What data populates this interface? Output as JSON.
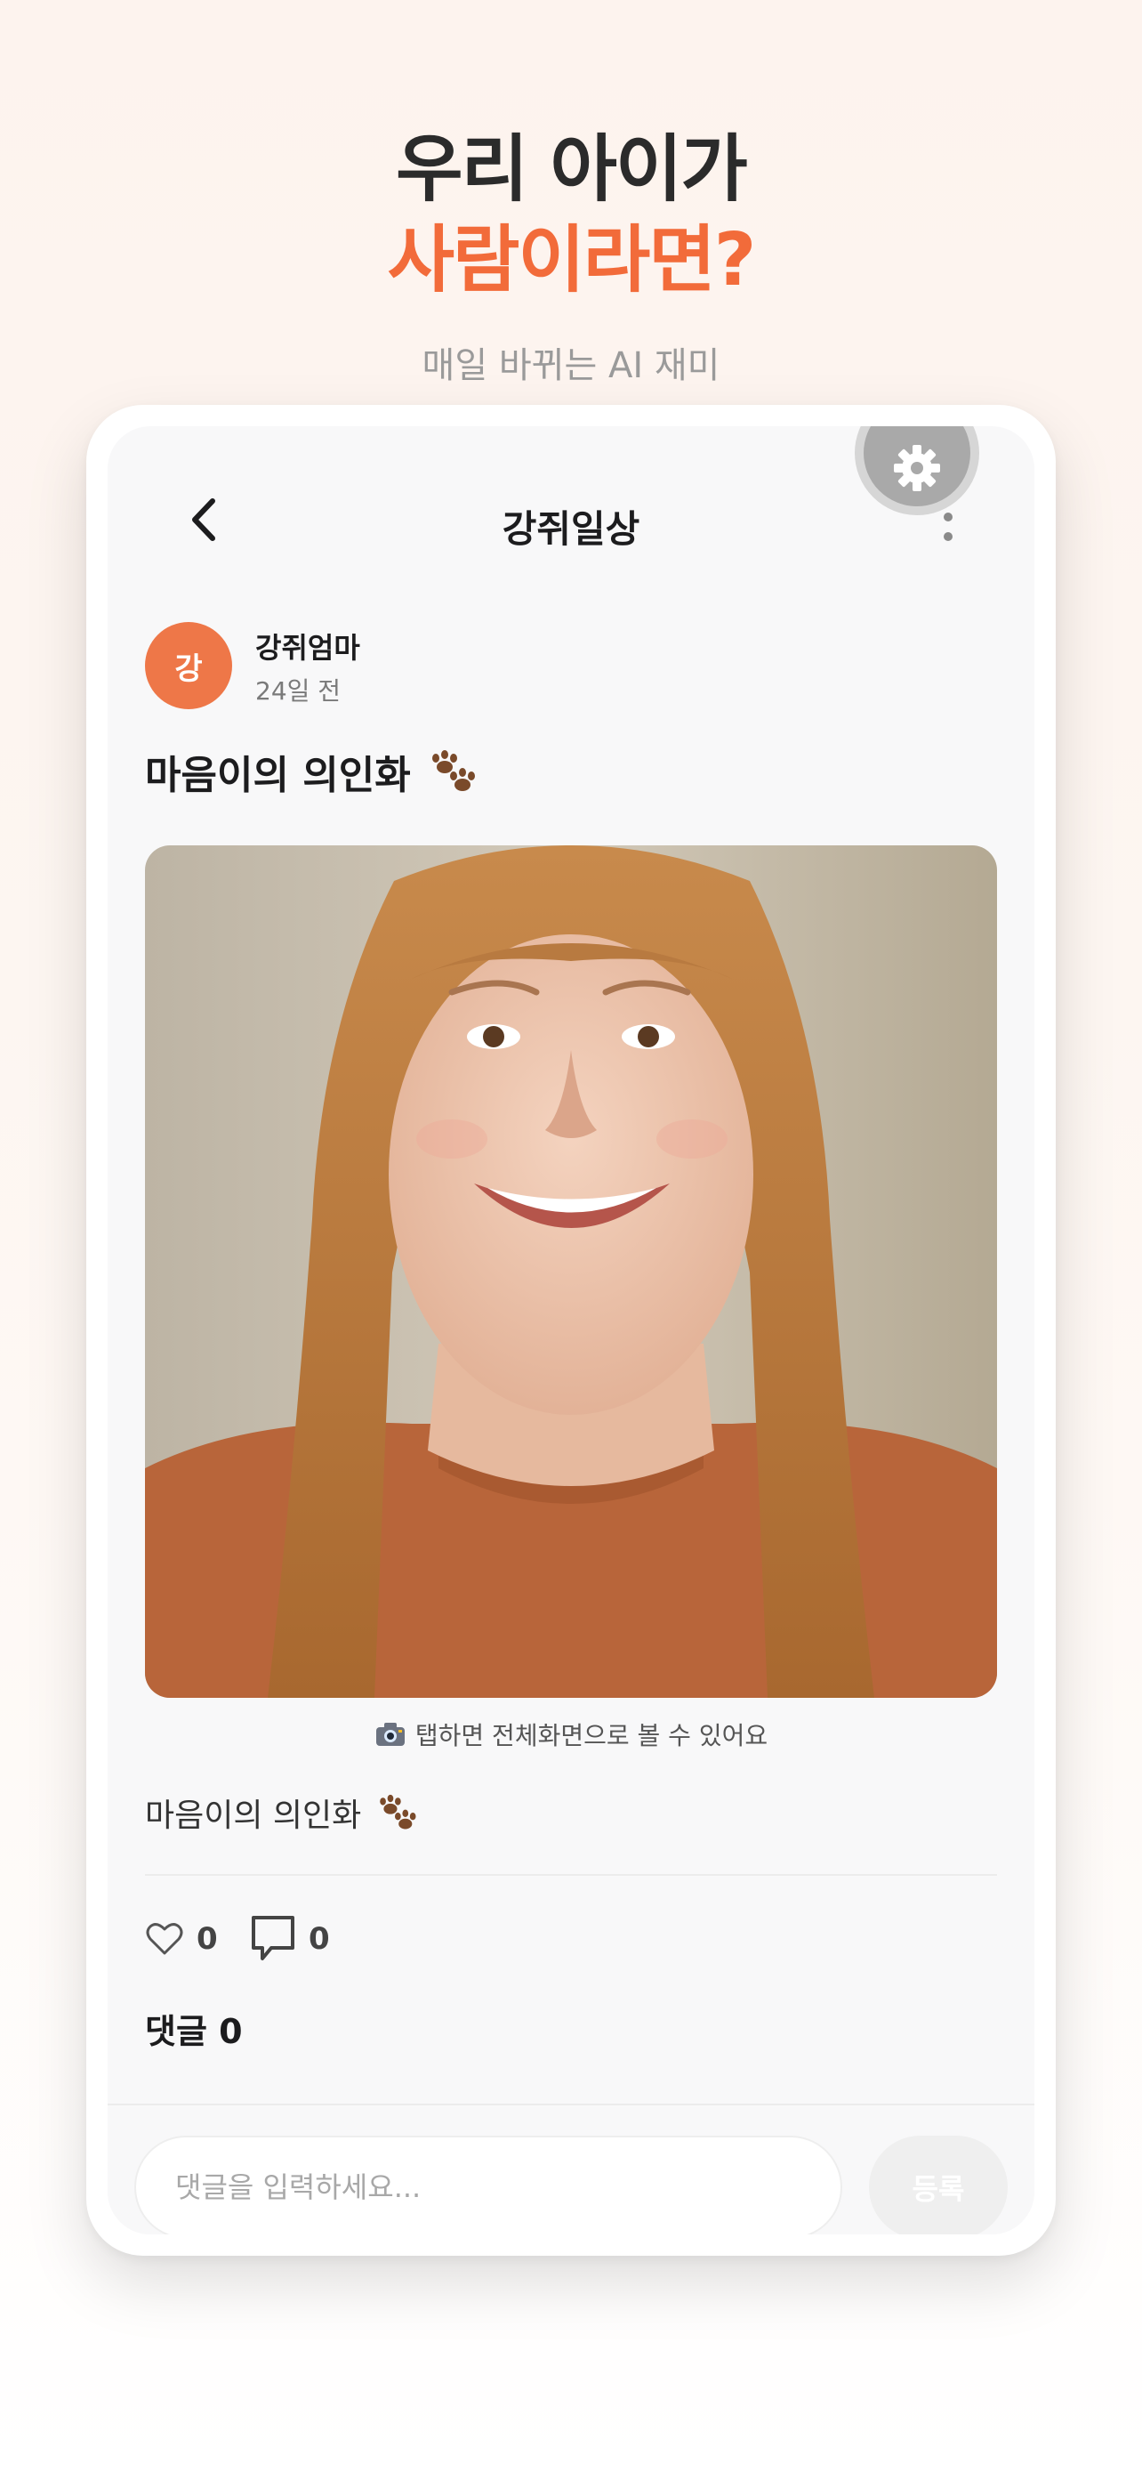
{
  "hero": {
    "line1": "우리 아이가",
    "line2": "사람이라면?",
    "subtitle": "매일 바뀌는 AI 재미"
  },
  "nav": {
    "title": "강쥐일상",
    "back_icon": "chevron-left-icon",
    "more_icon": "more-vertical-icon",
    "settings_icon": "gear-icon"
  },
  "post": {
    "avatar_text": "강",
    "author": "강쥐엄마",
    "time": "24일 전",
    "title": "마음이의 의인화",
    "title_emoji_icon": "paw-prints-icon",
    "tap_hint": "탭하면 전체화면으로 볼 수 있어요",
    "tap_hint_icon": "camera-icon",
    "body": "마음이의 의인화",
    "likes": "0",
    "comments": "0"
  },
  "comments_section": {
    "header": "댓글 0"
  },
  "input": {
    "placeholder": "댓글을 입력하세요...",
    "value": "",
    "submit_label": "등록"
  },
  "colors": {
    "accent": "#f26b3a",
    "avatar_bg": "#ee7748",
    "heading": "#2b2b2b"
  }
}
